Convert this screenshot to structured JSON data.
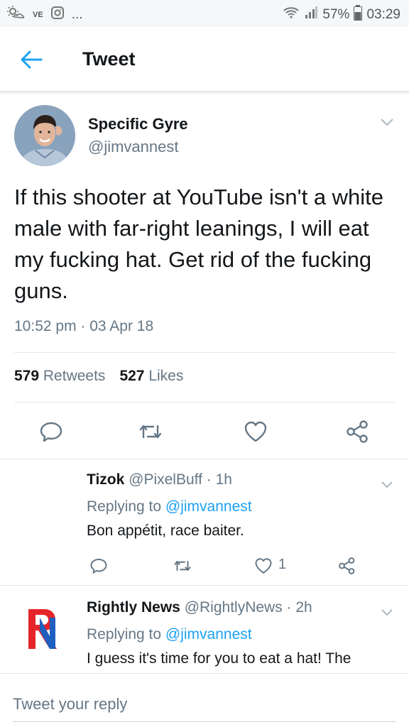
{
  "status_bar": {
    "carrier_tag": "VE",
    "more": "...",
    "battery": "57%",
    "time": "03:29"
  },
  "header": {
    "title": "Tweet"
  },
  "main_tweet": {
    "display_name": "Specific Gyre",
    "handle": "@jimvannest",
    "text": "If this shooter at YouTube isn't a white male with far-right leanings, I will eat my fucking hat. Get rid of the fucking guns.",
    "timestamp": "10:52 pm · 03 Apr 18",
    "retweets_count": "579",
    "retweets_label": "Retweets",
    "likes_count": "527",
    "likes_label": "Likes"
  },
  "replies": [
    {
      "display_name": "Tizok",
      "meta": "@PixelBuff · 1h",
      "replying_prefix": "Replying to",
      "replying_to": "@jimvannest",
      "text": "Bon appétit, race baiter.",
      "like_count": "1"
    },
    {
      "display_name": "Rightly News",
      "meta": "@RightlyNews · 2h",
      "replying_prefix": "Replying to",
      "replying_to": "@jimvannest",
      "text": "I guess it's time for you to eat a hat! The"
    }
  ],
  "composer": {
    "placeholder": "Tweet your reply"
  },
  "colors": {
    "accent": "#1da1f2",
    "muted": "#657786",
    "divider": "#e1e8ed"
  }
}
